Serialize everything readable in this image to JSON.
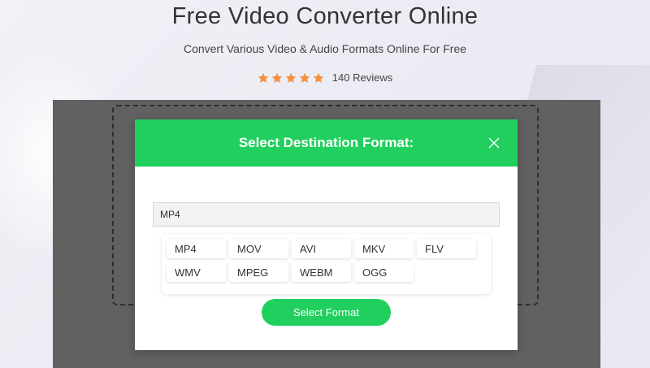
{
  "header": {
    "title": "Free Video Converter Online",
    "subtitle": "Convert Various Video & Audio Formats Online For Free",
    "rating": {
      "stars": 5,
      "star_color": "#f5903d",
      "reviews_label": "140 Reviews"
    }
  },
  "modal": {
    "title": "Select Destination Format:",
    "accent_color": "#21cf5e",
    "close_icon": "close-icon",
    "format_input": {
      "value": "MP4"
    },
    "formats": [
      "MP4",
      "MOV",
      "AVI",
      "MKV",
      "FLV",
      "WMV",
      "MPEG",
      "WEBM",
      "OGG"
    ],
    "select_button_label": "Select Format"
  }
}
